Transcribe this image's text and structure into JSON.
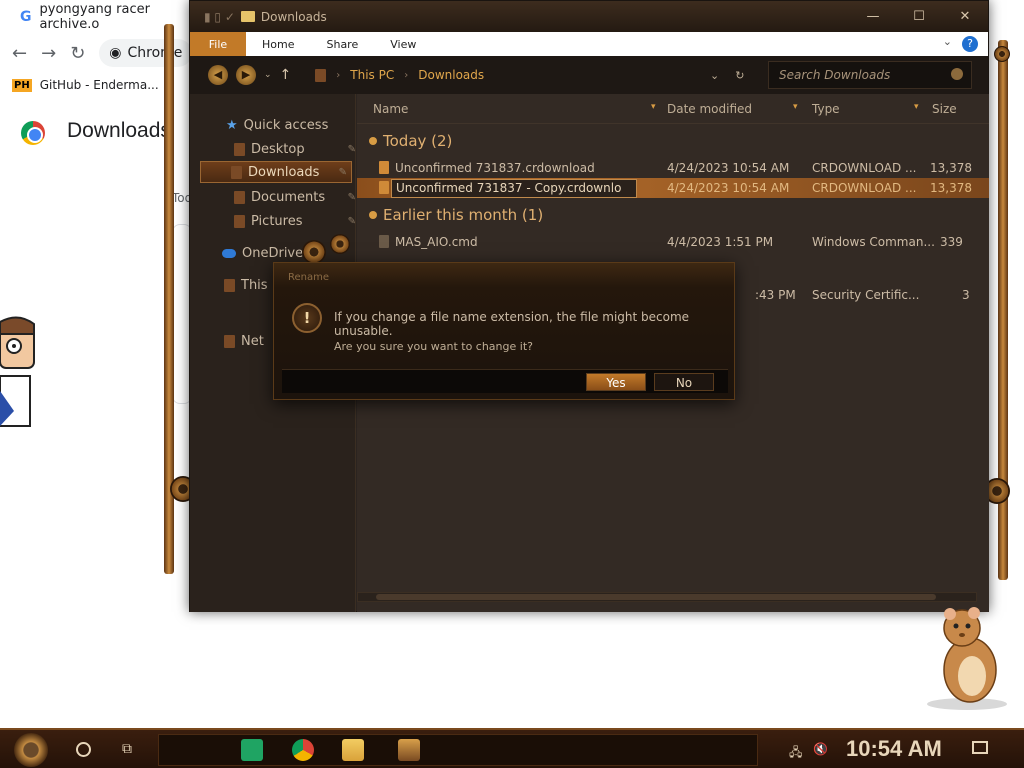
{
  "chrome": {
    "tab_title": "pyongyang racer archive.o",
    "omnibox": "Chrome",
    "bookmark_badge": "PH",
    "bookmark_label": "GitHub - Enderma...",
    "page_title": "Downloads",
    "today_label": "Today"
  },
  "explorer": {
    "window_title": "Downloads",
    "ribbon": {
      "file": "File",
      "home": "Home",
      "share": "Share",
      "view": "View",
      "help": "?"
    },
    "breadcrumb": [
      "This PC",
      "Downloads"
    ],
    "search_placeholder": "Search Downloads",
    "sidebar": {
      "quick_access": "Quick access",
      "desktop": "Desktop",
      "downloads": "Downloads",
      "documents": "Documents",
      "pictures": "Pictures",
      "onedrive": "OneDrive",
      "this_pc": "This P",
      "network": "Net"
    },
    "columns": {
      "name": "Name",
      "date": "Date modified",
      "type": "Type",
      "size": "Size"
    },
    "groups": {
      "today": "Today (2)",
      "earlier": "Earlier this month (1)"
    },
    "files": [
      {
        "name": "Unconfirmed 731837.crdownload",
        "date": "4/24/2023 10:54 AM",
        "type": "CRDOWNLOAD ...",
        "size": "13,378"
      },
      {
        "name": "Unconfirmed 731837 - Copy.crdownlo",
        "date": "4/24/2023 10:54 AM",
        "type": "CRDOWNLOAD ...",
        "size": "13,378"
      },
      {
        "name": "MAS_AIO.cmd",
        "date": "4/4/2023 1:51 PM",
        "type": "Windows Comman...",
        "size": "339"
      },
      {
        "name": "",
        "date": ":43 PM",
        "type": "Security Certific...",
        "size": "3"
      }
    ]
  },
  "dialog": {
    "title": "Rename",
    "message": "If you change a file name extension, the file might become unusable.",
    "question": "Are you sure you want to change it?",
    "yes": "Yes",
    "no": "No",
    "icon_glyph": "!"
  },
  "taskbar": {
    "clock": "10:54 AM"
  }
}
